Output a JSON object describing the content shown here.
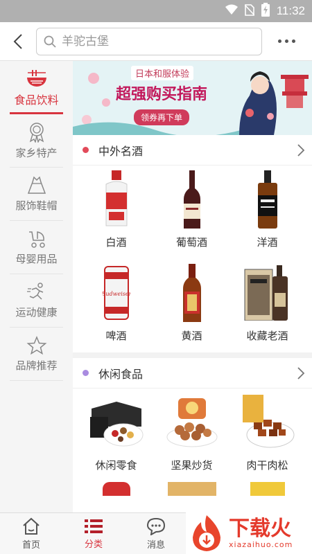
{
  "status_bar": {
    "time": "11:32"
  },
  "search": {
    "placeholder": "羊驼古堡"
  },
  "sidebar": {
    "items": [
      {
        "label": "食品饮料",
        "icon": "noodle-bowl-icon",
        "active": true
      },
      {
        "label": "家乡特产",
        "icon": "ribbon-badge-icon",
        "active": false
      },
      {
        "label": "服饰鞋帽",
        "icon": "dress-icon",
        "active": false
      },
      {
        "label": "母婴用品",
        "icon": "stroller-icon",
        "active": false
      },
      {
        "label": "运动健康",
        "icon": "running-person-icon",
        "active": false
      },
      {
        "label": "品牌推荐",
        "icon": "star-icon",
        "active": false
      }
    ]
  },
  "banner": {
    "line1": "日本和服体验",
    "line2": "超强购买指南",
    "button": "领券再下单"
  },
  "sections": [
    {
      "title": "中外名酒",
      "dot_color": "#e24a5a",
      "items": [
        {
          "name": "白酒"
        },
        {
          "name": "葡萄酒"
        },
        {
          "name": "洋酒"
        },
        {
          "name": "啤酒"
        },
        {
          "name": "黄酒"
        },
        {
          "name": "收藏老酒"
        }
      ]
    },
    {
      "title": "休闲食品",
      "dot_color": "#a98be0",
      "items": [
        {
          "name": "休闲零食"
        },
        {
          "name": "坚果炒货"
        },
        {
          "name": "肉干肉松"
        }
      ]
    }
  ],
  "tabbar": {
    "tabs": [
      {
        "label": "首页",
        "icon": "home-icon"
      },
      {
        "label": "分类",
        "icon": "list-icon",
        "active": true
      },
      {
        "label": "消息",
        "icon": "chat-bubble-icon"
      }
    ]
  },
  "watermark": {
    "text": "下载火",
    "sub": "xiazaihuo.com"
  },
  "colors": {
    "accent": "#d8343e"
  }
}
